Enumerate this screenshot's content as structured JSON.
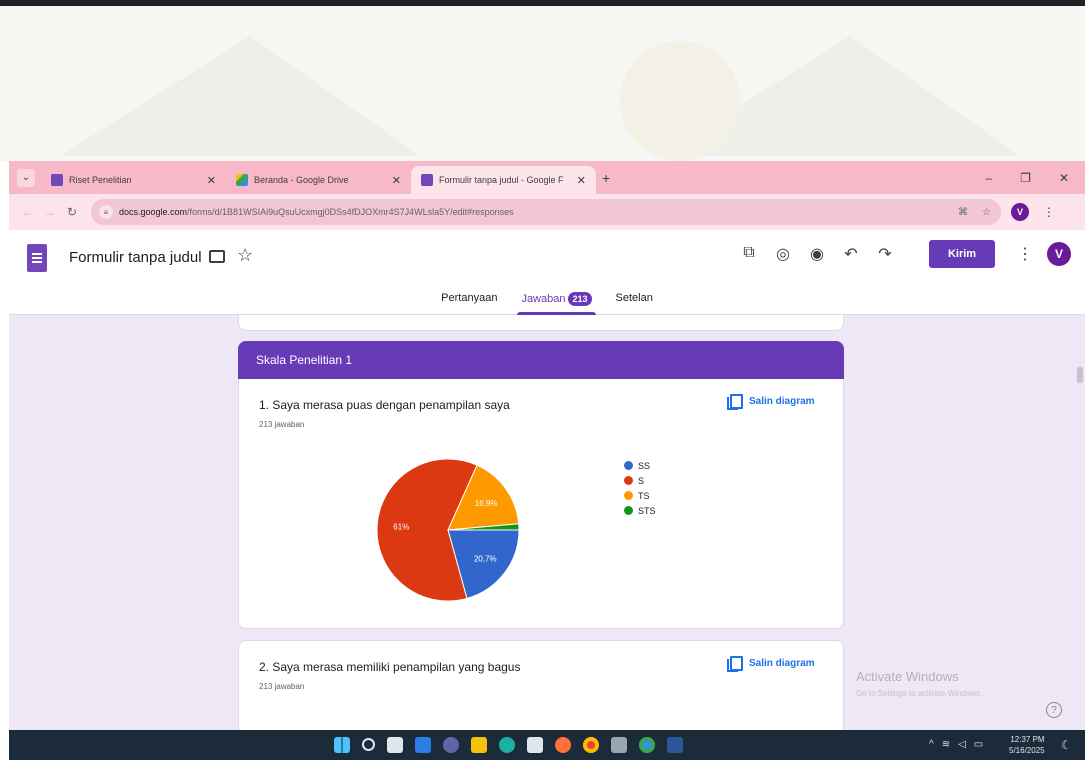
{
  "browser": {
    "tabs": [
      {
        "title": "Riset Penelitian",
        "active": false,
        "favicon": "forms-icon"
      },
      {
        "title": "Beranda - Google Drive",
        "active": false,
        "favicon": "drive-icon"
      },
      {
        "title": "Formulir tanpa judul - Google F",
        "active": true,
        "favicon": "forms-icon"
      }
    ],
    "new_tab": "+",
    "url_host": "docs.google.com",
    "url_path": "/forms/d/1B81WSIAi9uQsuUcxmgj0DSs4fDJOXmr4S7J4WLsla5Y/edit#responses",
    "profile_initial": "V"
  },
  "forms": {
    "title": "Formulir tanpa judul",
    "send_label": "Kirim",
    "avatar_initial": "V",
    "tabs": [
      {
        "label": "Pertanyaan",
        "active": false
      },
      {
        "label": "Jawaban",
        "active": true,
        "badge": "213"
      },
      {
        "label": "Setelan",
        "active": false
      }
    ],
    "brand_color": "#673ab7"
  },
  "section": {
    "title": "Skala Penelitian 1"
  },
  "questions": [
    {
      "title": "1. Saya merasa puas dengan penampilan saya",
      "responses": "213 jawaban",
      "copy_label": "Salin diagram"
    },
    {
      "title": "2. Saya merasa memiliki penampilan yang bagus",
      "responses": "213 jawaban",
      "copy_label": "Salin diagram"
    }
  ],
  "chart_data": {
    "type": "pie",
    "categories": [
      "SS",
      "S",
      "TS",
      "STS"
    ],
    "values": [
      20.7,
      61.0,
      16.9,
      1.4
    ],
    "data_labels": [
      "20,7%",
      "61%",
      "16,9%",
      ""
    ],
    "colors": [
      "#3366cc",
      "#dc3912",
      "#ff9900",
      "#109618"
    ],
    "legend_position": "right"
  },
  "watermark": {
    "activate_title": "Activate Windows",
    "activate_sub": "Go to Settings to activate Windows."
  },
  "taskbar": {
    "time": "12:37 PM",
    "date": "5/16/2025"
  }
}
